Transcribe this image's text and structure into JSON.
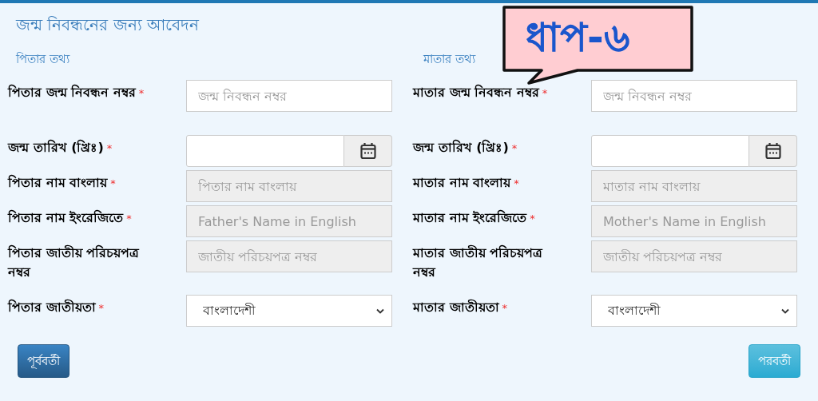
{
  "title": "জন্ম নিবন্ধনের জন্য আবেদন",
  "callout": {
    "text": "ধাপ-৬"
  },
  "sections": [
    {
      "heading": "পিতার তথ্য",
      "fields": [
        {
          "label": "পিতার জন্ম নিবন্ধন নম্বর",
          "required_mark": "*",
          "kind": "text",
          "placeholder": "জন্ম নিবন্ধন নম্বর",
          "disabled": false
        },
        {
          "label": "জন্ম তারিখ (খ্রিঃ)",
          "required_mark": "*",
          "kind": "date",
          "disabled": false
        },
        {
          "label": "পিতার নাম বাংলায়",
          "required_mark": "*",
          "kind": "text",
          "placeholder": "পিতার নাম বাংলায়",
          "disabled": true
        },
        {
          "label": "পিতার নাম ইংরেজিতে",
          "required_mark": "*",
          "kind": "text",
          "placeholder": "Father's Name in English",
          "disabled": true
        },
        {
          "label": "পিতার জাতীয় পরিচয়পত্র নম্বর",
          "kind": "text",
          "placeholder": "জাতীয় পরিচয়পত্র নম্বর",
          "disabled": true
        },
        {
          "label": "পিতার জাতীয়তা",
          "required_mark": "*",
          "kind": "select",
          "value": "বাংলাদেশী",
          "disabled": false
        }
      ]
    },
    {
      "heading": "মাতার তথ্য",
      "fields": [
        {
          "label": "মাতার জন্ম নিবন্ধন নম্বর",
          "required_mark": "*",
          "kind": "text",
          "placeholder": "জন্ম নিবন্ধন নম্বর",
          "disabled": false
        },
        {
          "label": "জন্ম তারিখ (খ্রিঃ)",
          "required_mark": "*",
          "kind": "date",
          "disabled": false
        },
        {
          "label": "মাতার নাম বাংলায়",
          "required_mark": "*",
          "kind": "text",
          "placeholder": "মাতার নাম বাংলায়",
          "disabled": true
        },
        {
          "label": "মাতার নাম ইংরেজিতে",
          "required_mark": "*",
          "kind": "text",
          "placeholder": "Mother's Name in English",
          "disabled": true
        },
        {
          "label": "মাতার জাতীয় পরিচয়পত্র নম্বর",
          "kind": "text",
          "placeholder": "জাতীয় পরিচয়পত্র নম্বর",
          "disabled": true
        },
        {
          "label": "মাতার জাতীয়তা",
          "required_mark": "*",
          "kind": "select",
          "value": "বাংলাদেশী",
          "disabled": false
        }
      ]
    }
  ],
  "buttons": [
    {
      "label": "পূর্ববর্তী",
      "kind": "previous"
    },
    {
      "label": "পরবর্তী",
      "kind": "next"
    }
  ]
}
